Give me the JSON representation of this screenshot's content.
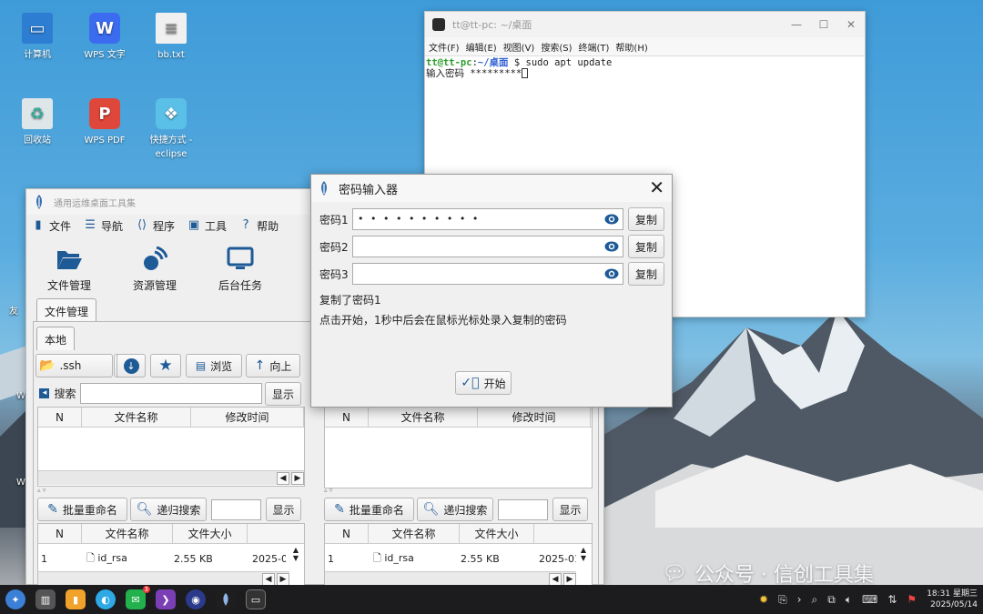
{
  "desktop": {
    "icons": [
      {
        "label": "计算机",
        "icon": "computer-icon"
      },
      {
        "label": "WPS 文字",
        "icon": "wps-writer-icon"
      },
      {
        "label": "bb.txt",
        "icon": "text-file-icon"
      },
      {
        "label": "回收站",
        "icon": "recycle-bin-icon"
      },
      {
        "label": "WPS PDF",
        "icon": "wps-pdf-icon"
      },
      {
        "label": "快捷方式 -",
        "label2": "eclipse",
        "icon": "shortcut-icon"
      }
    ],
    "partial_left_text": "友",
    "partial_left_w1": "W",
    "partial_left_w2": "W"
  },
  "terminal": {
    "title": "tt@tt-pc: ~/桌面",
    "menu": [
      "文件(F)",
      "编辑(E)",
      "视图(V)",
      "搜索(S)",
      "终端(T)",
      "帮助(H)"
    ],
    "prompt_user": "tt@tt-pc",
    "prompt_sep": ":",
    "prompt_path": "~/桌面",
    "command": "$ sudo apt update",
    "password_prompt": "输入密码 *********"
  },
  "toolwin": {
    "title": "通用运维桌面工具集",
    "menu": [
      "文件",
      "导航",
      "程序",
      "工具",
      "帮助"
    ],
    "big_buttons": [
      "文件管理",
      "资源管理",
      "后台任务"
    ],
    "outer_tab": "文件管理",
    "inner_tab": "本地",
    "path_value": ".ssh",
    "browse_label": "浏览",
    "up_label": "向上",
    "search_label": "搜索",
    "show_label": "显示",
    "dir_columns": [
      "N",
      "文件名称",
      "修改时间"
    ],
    "batch_rename": "批量重命名",
    "recursive_search": "递归搜索",
    "file_columns": [
      "N",
      "文件名称",
      "文件大小"
    ],
    "file_row": {
      "n": "1",
      "name": "id_rsa",
      "size": "2.55 KB",
      "date": "2025-0"
    },
    "file_row_right": {
      "n": "1",
      "name": "id_rsa",
      "size": "2.55 KB",
      "date": "2025-01"
    }
  },
  "pwdialog": {
    "title": "密码输入器",
    "rows": [
      {
        "label": "密码1",
        "value": "• • • • • • • • • •"
      },
      {
        "label": "密码2",
        "value": ""
      },
      {
        "label": "密码3",
        "value": ""
      }
    ],
    "copy_label": "复制",
    "status": "复制了密码1",
    "hint": "点击开始，1秒中后会在鼠标光标处录入复制的密码",
    "start_label": "开始"
  },
  "taskbar": {
    "badge": "3",
    "time": "18:31 星期三",
    "date": "2025/05/14"
  },
  "watermark": "公众号 · 信创工具集"
}
